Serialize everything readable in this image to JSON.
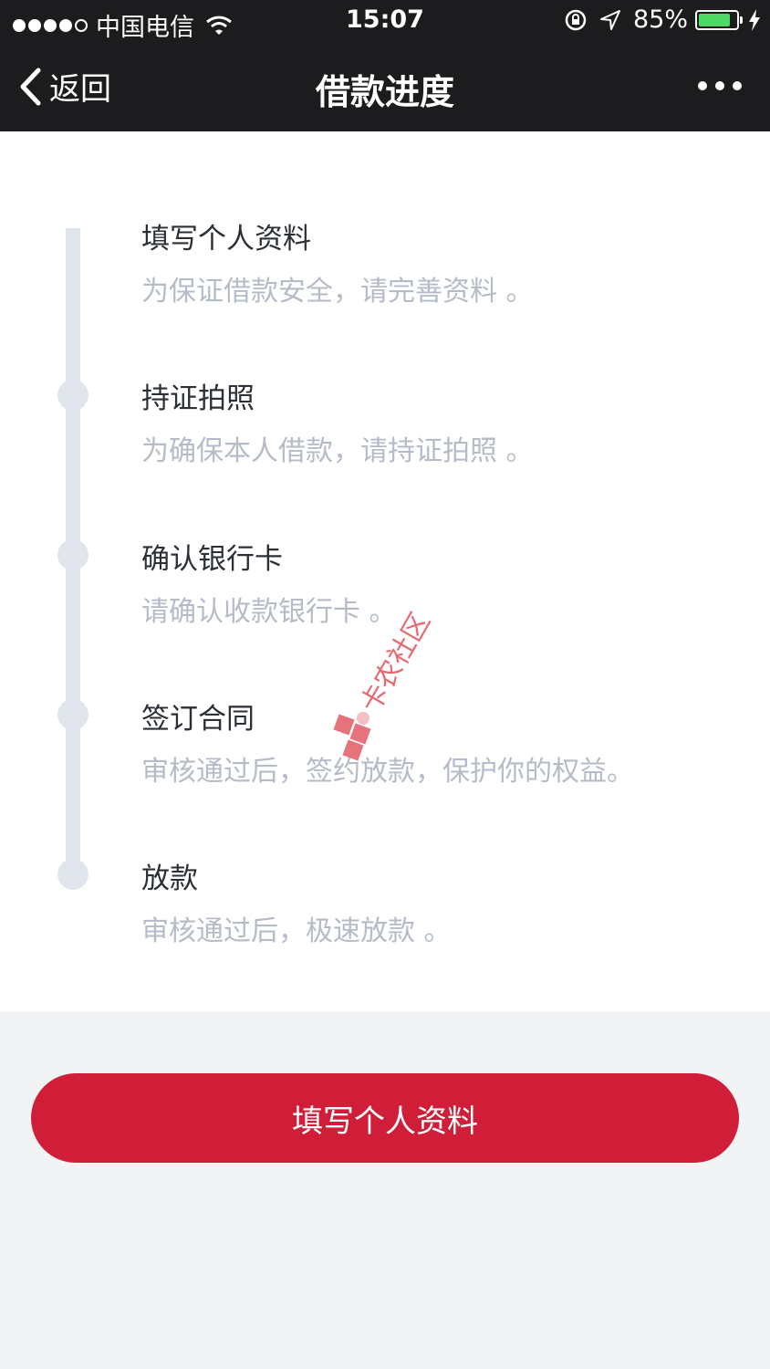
{
  "status_bar": {
    "carrier": "中国电信",
    "time": "15:07",
    "battery_percent": "85%",
    "battery_level": 0.85,
    "icons": [
      "signal-dots-icon",
      "wifi-icon",
      "orientation-lock-icon",
      "location-arrow-icon",
      "battery-icon",
      "charging-bolt-icon"
    ]
  },
  "nav": {
    "back_label": "返回",
    "title": "借款进度",
    "more_icon": "more-dots-icon"
  },
  "steps": [
    {
      "title": "填写个人资料",
      "desc": "为保证借款安全，请完善资料 。"
    },
    {
      "title": "持证拍照",
      "desc": "为确保本人借款，请持证拍照 。"
    },
    {
      "title": "确认银行卡",
      "desc": "请确认收款银行卡 。"
    },
    {
      "title": "签订合同",
      "desc": "审核通过后，签约放款，保护你的权益。"
    },
    {
      "title": "放款",
      "desc": "审核通过后，极速放款 。"
    }
  ],
  "watermark": {
    "text": "卡农社区"
  },
  "action": {
    "button_label": "填写个人资料"
  },
  "colors": {
    "header_bg": "#1c1c1e",
    "accent": "#d01d38",
    "timeline": "#e1e6ee",
    "desc_text": "#b5bcc8",
    "battery_fill": "#4cd964"
  }
}
